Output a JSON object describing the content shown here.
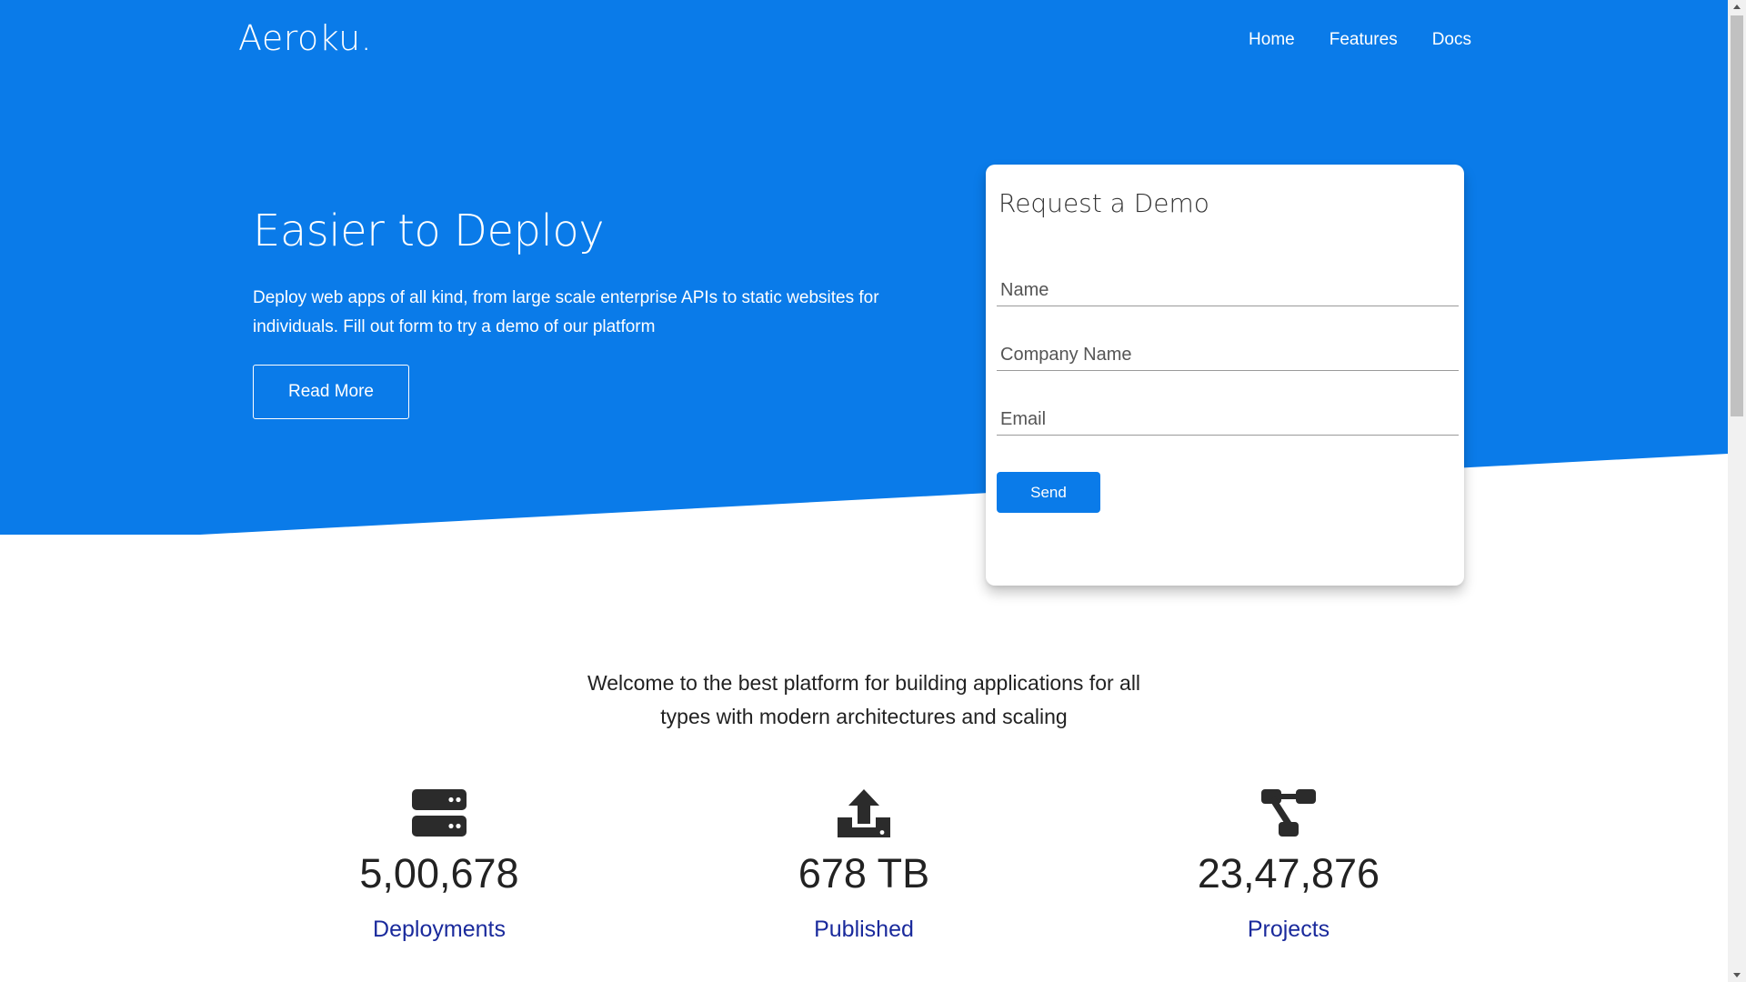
{
  "brand": {
    "logo": "Aeroku."
  },
  "nav": {
    "items": [
      "Home",
      "Features",
      "Docs"
    ]
  },
  "hero": {
    "title": "Easier to Deploy",
    "description": "Deploy web apps of all kind, from large scale enterprise APIs to static websites for individuals. Fill out form to try a demo of our platform",
    "read_more_label": "Read More"
  },
  "demo_form": {
    "title": "Request a Demo",
    "name_placeholder": "Name",
    "company_placeholder": "Company Name",
    "email_placeholder": "Email",
    "send_label": "Send"
  },
  "intro": {
    "line1": "Welcome to the best platform for building applications for all",
    "line2": "types with modern architectures and scaling"
  },
  "stats": [
    {
      "icon": "server-icon",
      "value": "5,00,678",
      "label": "Deployments"
    },
    {
      "icon": "upload-icon",
      "value": "678 TB",
      "label": "Published"
    },
    {
      "icon": "project-diagram-icon",
      "value": "23,47,876",
      "label": "Projects"
    }
  ],
  "colors": {
    "primary": "#0a7be9",
    "stat_label": "#1a2a9c",
    "text": "#222222"
  }
}
